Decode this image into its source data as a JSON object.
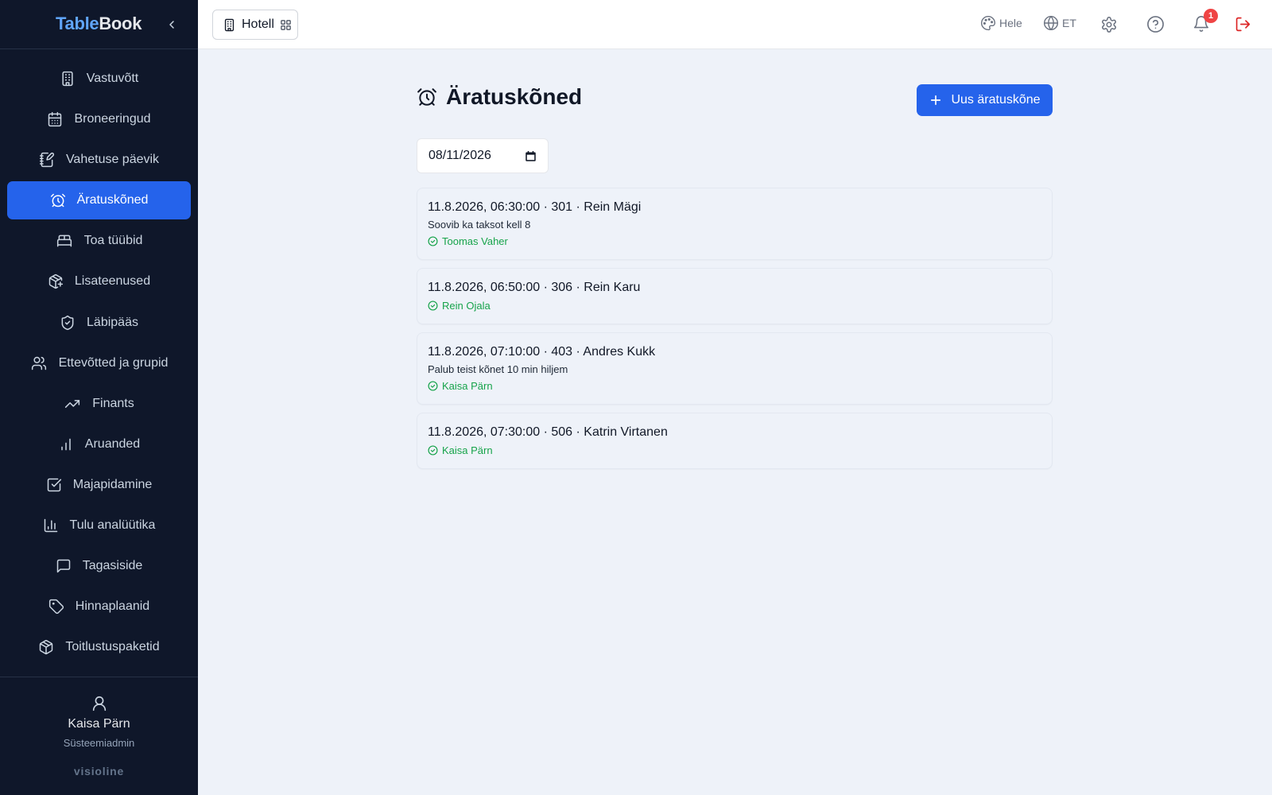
{
  "sidebar": {
    "logo_part1": "Table",
    "logo_part2": "Book",
    "items": [
      {
        "label": "Vastuvõtt",
        "icon": "building-icon",
        "active": false
      },
      {
        "label": "Broneeringud",
        "icon": "calendar-icon",
        "active": false
      },
      {
        "label": "Vahetuse päevik",
        "icon": "notebook-pen-icon",
        "active": false
      },
      {
        "label": "Äratuskõned",
        "icon": "alarm-clock-icon",
        "active": true
      },
      {
        "label": "Toa tüübid",
        "icon": "bed-icon",
        "active": false
      },
      {
        "label": "Lisateenused",
        "icon": "package-plus-icon",
        "active": false
      },
      {
        "label": "Läbipääs",
        "icon": "shield-check-icon",
        "active": false
      },
      {
        "label": "Ettevõtted ja grupid",
        "icon": "users-icon",
        "active": false
      },
      {
        "label": "Finants",
        "icon": "trending-up-icon",
        "active": false
      },
      {
        "label": "Aruanded",
        "icon": "bar-chart-icon",
        "active": false
      },
      {
        "label": "Majapidamine",
        "icon": "check-square-icon",
        "active": false
      },
      {
        "label": "Tulu analüütika",
        "icon": "chart-columns-icon",
        "active": false
      },
      {
        "label": "Tagasiside",
        "icon": "message-square-icon",
        "active": false
      },
      {
        "label": "Hinnaplaanid",
        "icon": "tag-icon",
        "active": false
      },
      {
        "label": "Toitlustuspaketid",
        "icon": "box-icon",
        "active": false
      }
    ],
    "user": {
      "name": "Kaisa Pärn",
      "role": "Süsteemiadmin"
    },
    "brand": "visioline"
  },
  "topbar": {
    "property_label": "Hotell",
    "theme_label": "Hele",
    "language_label": "ET",
    "notification_count": "1"
  },
  "main": {
    "title": "Äratuskõned",
    "new_button_label": "Uus äratuskõne",
    "date_value": "08/11/2026",
    "calls": [
      {
        "title": "11.8.2026, 06:30:00 · 301 · Rein Mägi",
        "note": "Soovib ka taksot kell 8",
        "done_by": "Toomas Vaher"
      },
      {
        "title": "11.8.2026, 06:50:00 · 306 · Rein Karu",
        "note": "",
        "done_by": "Rein Ojala"
      },
      {
        "title": "11.8.2026, 07:10:00 · 403 · Andres Kukk",
        "note": "Palub teist kõnet 10 min hiljem",
        "done_by": "Kaisa Pärn"
      },
      {
        "title": "11.8.2026, 07:30:00 · 506 · Katrin Virtanen",
        "note": "",
        "done_by": "Kaisa Pärn"
      }
    ]
  },
  "colors": {
    "accent": "#2563eb",
    "sidebar_bg": "#0f172a",
    "success": "#16a34a",
    "danger": "#ef4444"
  }
}
